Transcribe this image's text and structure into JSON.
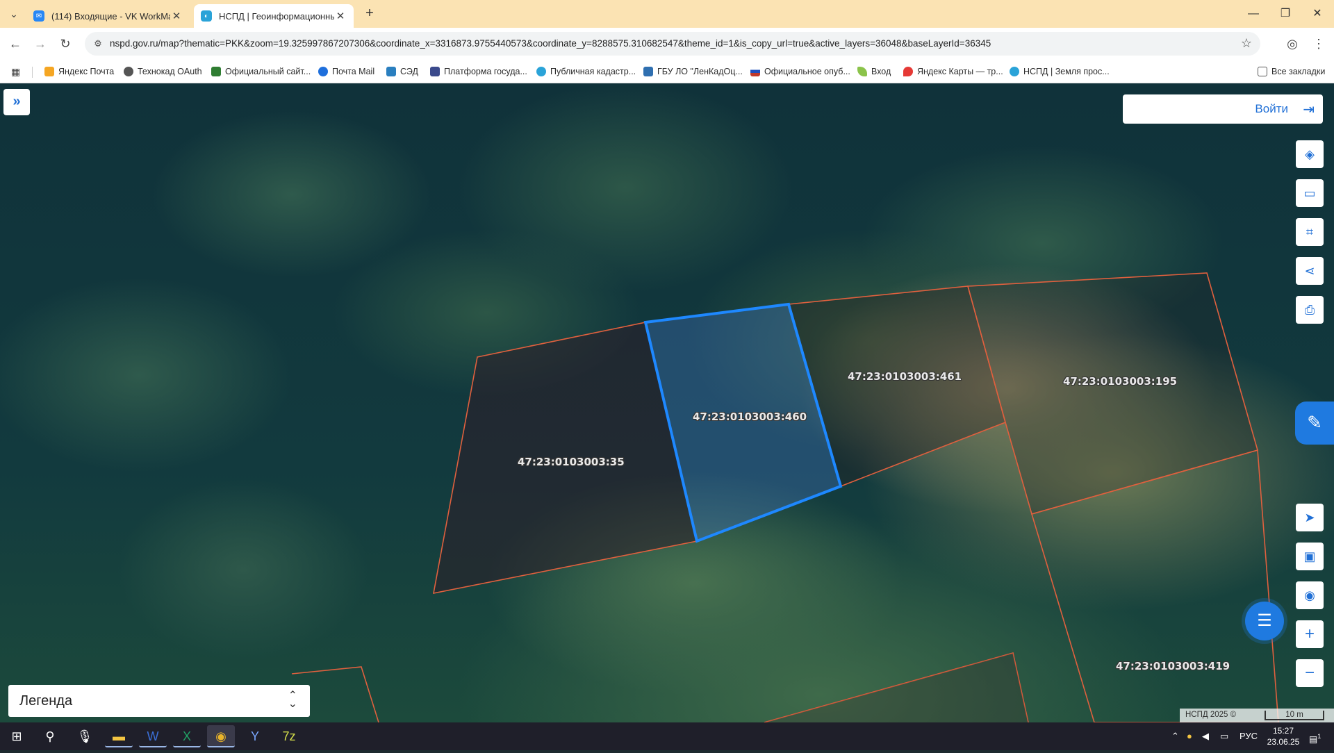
{
  "browser": {
    "tabs": [
      {
        "title": "(114) Входящие - VK WorkMail",
        "favicon": "vk-workmail-icon",
        "active": false
      },
      {
        "title": "НСПД | Геоинформационный",
        "favicon": "nspd-icon",
        "active": true
      }
    ],
    "url": "nspd.gov.ru/map?thematic=PKK&zoom=19.325997867207306&coordinate_x=3316873.9755440573&coordinate_y=8288575.310682547&theme_id=1&is_copy_url=true&active_layers=36048&baseLayerId=36345",
    "bookmarks": [
      {
        "label": "Яндекс Почта",
        "color": "#f5a623"
      },
      {
        "label": "Технокад OAuth",
        "color": "#555555"
      },
      {
        "label": "Официальный сайт...",
        "color": "#2f7d32"
      },
      {
        "label": "Почта Mail",
        "color": "#1e6fdc"
      },
      {
        "label": "СЭД",
        "color": "#2a7fbf"
      },
      {
        "label": "Платформа госуда...",
        "color": "#3b4a8c"
      },
      {
        "label": "Публичная кадастр...",
        "color": "#2aa3d8"
      },
      {
        "label": "ГБУ ЛО \"ЛенКадОц...",
        "color": "#2f6fb0"
      },
      {
        "label": "Официальное опуб...",
        "color": "#c0392b"
      },
      {
        "label": "Вход",
        "color": "#8bc34a"
      },
      {
        "label": "Яндекс Карты — тр...",
        "color": "#e53935"
      },
      {
        "label": "НСПД | Земля прос...",
        "color": "#2aa3d8"
      }
    ],
    "all_bookmarks": "Все закладки"
  },
  "map": {
    "login_label": "Войти",
    "legend_label": "Легенда",
    "attribution": "НСПД 2025 ©",
    "scale_label": "10 m",
    "parcels": [
      {
        "id": "47:23:0103003:35",
        "selected": false
      },
      {
        "id": "47:23:0103003:460",
        "selected": true
      },
      {
        "id": "47:23:0103003:461",
        "selected": false
      },
      {
        "id": "47:23:0103003:195",
        "selected": false
      },
      {
        "id": "47:23:0103003:419",
        "selected": false
      }
    ],
    "colors": {
      "parcel_border": "#e0603e",
      "selected_border": "#1e88ff",
      "accent": "#1f7ae0"
    }
  },
  "taskbar": {
    "language": "РУС",
    "time": "15:27",
    "date": "23.06.25",
    "notifications": "1"
  }
}
